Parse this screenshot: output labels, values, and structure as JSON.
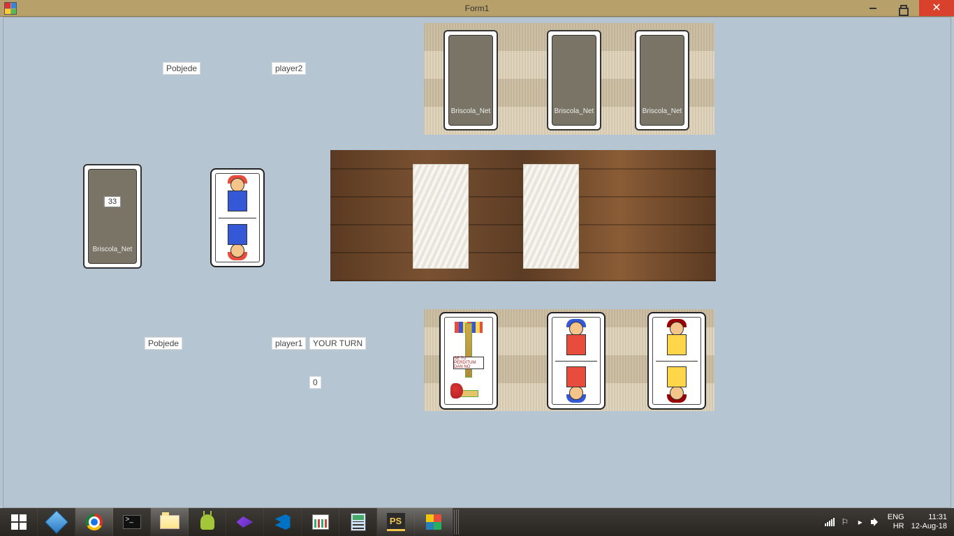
{
  "window": {
    "title": "Form1"
  },
  "player2": {
    "wins_label": "Pobjede",
    "name": "player2"
  },
  "player1": {
    "wins_label": "Pobjede",
    "name": "player1",
    "turn_text": "YOUR TURN",
    "score": "0"
  },
  "deck": {
    "remaining": "33",
    "back_text": "Briscola_Net"
  },
  "opponent_backs": [
    "Briscola_Net",
    "Briscola_Net",
    "Briscola_Net"
  ],
  "sette_banner": "SE TU PERDITUM DAN NO",
  "tray": {
    "lang1": "ENG",
    "lang2": "HR",
    "time": "11:31",
    "date": "12-Aug-18"
  }
}
